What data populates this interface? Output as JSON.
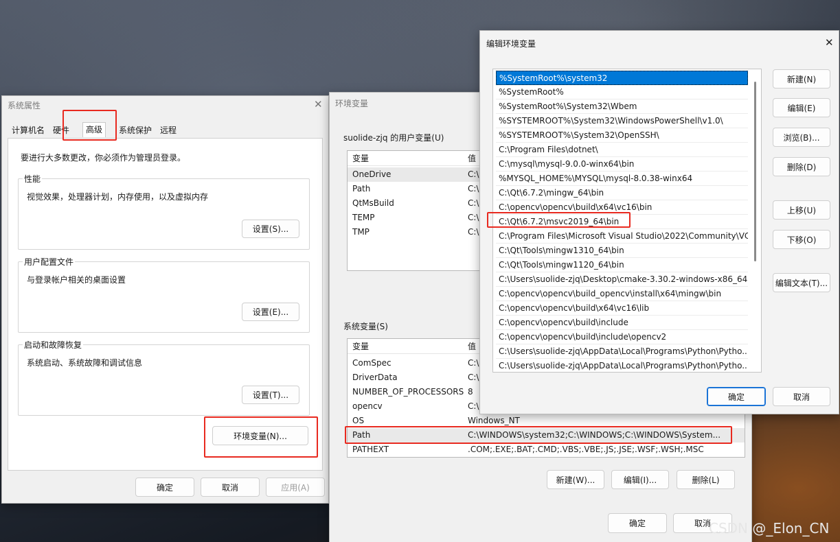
{
  "system_props": {
    "title": "系统属性",
    "tabs": [
      "计算机名",
      "硬件",
      "高级",
      "系统保护",
      "远程"
    ],
    "admin_note": "要进行大多数更改，你必须作为管理员登录。",
    "perf": {
      "label": "性能",
      "desc": "视觉效果，处理器计划，内存使用，以及虚拟内存",
      "button": "设置(S)..."
    },
    "profile": {
      "label": "用户配置文件",
      "desc": "与登录帐户相关的桌面设置",
      "button": "设置(E)..."
    },
    "startup": {
      "label": "启动和故障恢复",
      "desc": "系统启动、系统故障和调试信息",
      "button": "设置(T)..."
    },
    "env_button": "环境变量(N)...",
    "ok": "确定",
    "cancel": "取消",
    "apply": "应用(A)"
  },
  "env_vars": {
    "title": "环境变量",
    "user_label": "suolide-zjq 的用户变量(U)",
    "col_var": "变量",
    "col_val": "值",
    "user_rows": [
      {
        "name": "OneDrive",
        "value": "C:\\"
      },
      {
        "name": "Path",
        "value": "C:\\"
      },
      {
        "name": "QtMsBuild",
        "value": "C:\\"
      },
      {
        "name": "TEMP",
        "value": "C:\\"
      },
      {
        "name": "TMP",
        "value": "C:\\"
      }
    ],
    "sys_label": "系统变量(S)",
    "sys_rows": [
      {
        "name": "ComSpec",
        "value": "C:\\"
      },
      {
        "name": "DriverData",
        "value": "C:\\"
      },
      {
        "name": "NUMBER_OF_PROCESSORS",
        "value": "8"
      },
      {
        "name": "opencv",
        "value": "C:\\"
      },
      {
        "name": "OS",
        "value": "Windows_NT"
      },
      {
        "name": "Path",
        "value": "C:\\WINDOWS\\system32;C:\\WINDOWS;C:\\WINDOWS\\System..."
      },
      {
        "name": "PATHEXT",
        "value": ".COM;.EXE;.BAT;.CMD;.VBS;.VBE;.JS;.JSE;.WSF;.WSH;.MSC"
      }
    ],
    "new_btn": "新建(W)...",
    "edit_btn": "编辑(I)...",
    "delete_btn": "删除(L)",
    "ok": "确定",
    "cancel": "取消"
  },
  "edit_env": {
    "title": "编辑环境变量",
    "items": [
      "%SystemRoot%\\system32",
      "%SystemRoot%",
      "%SystemRoot%\\System32\\Wbem",
      "%SYSTEMROOT%\\System32\\WindowsPowerShell\\v1.0\\",
      "%SYSTEMROOT%\\System32\\OpenSSH\\",
      "C:\\Program Files\\dotnet\\",
      "C:\\mysql\\mysql-9.0.0-winx64\\bin",
      "%MYSQL_HOME%\\MYSQL\\mysql-8.0.38-winx64",
      "C:\\Qt\\6.7.2\\mingw_64\\bin",
      "C:\\opencv\\opencv\\build\\x64\\vc16\\bin",
      "C:\\Qt\\6.7.2\\msvc2019_64\\bin",
      "C:\\Program Files\\Microsoft Visual Studio\\2022\\Community\\VC",
      "C:\\Qt\\Tools\\mingw1310_64\\bin",
      "C:\\Qt\\Tools\\mingw1120_64\\bin",
      "C:\\Users\\suolide-zjq\\Desktop\\cmake-3.30.2-windows-x86_64...",
      "C:\\opencv\\opencv\\build_opencv\\install\\x64\\mingw\\bin",
      "C:\\opencv\\opencv\\build\\x64\\vc16\\lib",
      "C:\\opencv\\opencv\\build\\include",
      "C:\\opencv\\opencv\\build\\include\\opencv2",
      "C:\\Users\\suolide-zjq\\AppData\\Local\\Programs\\Python\\Pytho...",
      "C:\\Users\\suolide-zjq\\AppData\\Local\\Programs\\Python\\Pytho..."
    ],
    "buttons": [
      "新建(N)",
      "编辑(E)",
      "浏览(B)...",
      "删除(D)",
      "上移(U)",
      "下移(O)",
      "编辑文本(T)..."
    ],
    "ok": "确定",
    "cancel": "取消"
  },
  "watermark": "CSDN @_Elon_CN",
  "colors": {
    "highlight": "#e8291f",
    "selection": "#0078d7"
  }
}
